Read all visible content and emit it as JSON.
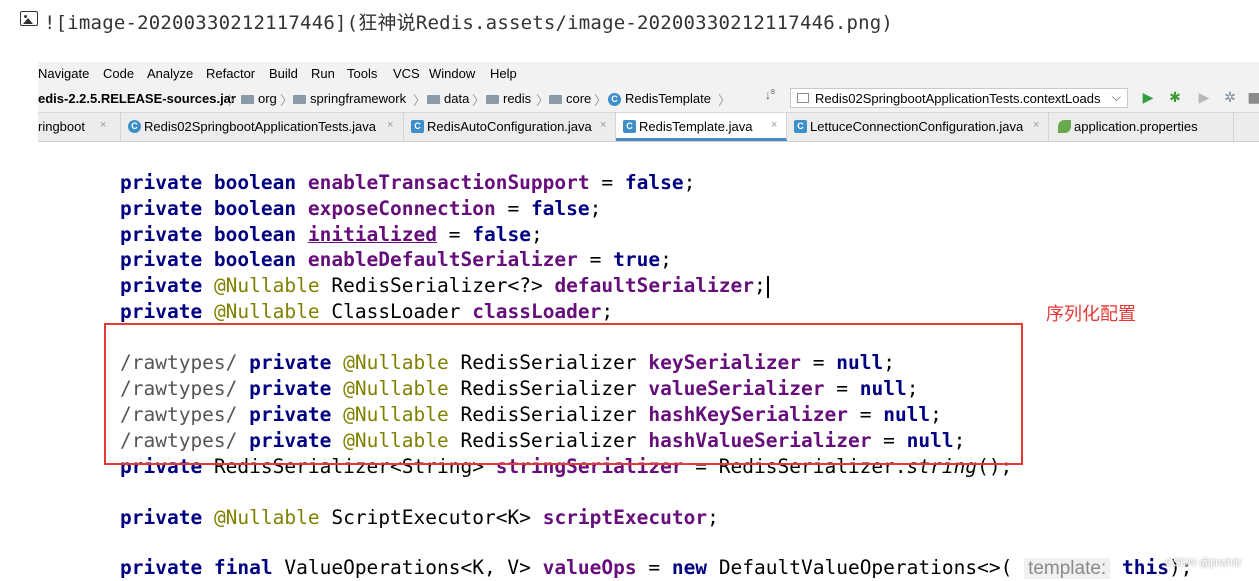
{
  "markdown": {
    "text": "![image-20200330212117446](狂神说Redis.assets/image-20200330212117446.png)"
  },
  "menu": [
    "Navigate",
    "Code",
    "Analyze",
    "Refactor",
    "Build",
    "Run",
    "Tools",
    "VCS",
    "Window",
    "Help"
  ],
  "breadcrumb": {
    "jar": "edis-2.2.5.RELEASE-sources.jar",
    "folders": [
      "org",
      "springframework",
      "data",
      "redis",
      "core"
    ],
    "class": "RedisTemplate"
  },
  "run_config": {
    "label": "Redis02SpringbootApplicationTests.contextLoads"
  },
  "tabs": [
    {
      "label": "ringboot",
      "active": false
    },
    {
      "label": "Redis02SpringbootApplicationTests.java",
      "active": false
    },
    {
      "label": "RedisAutoConfiguration.java",
      "active": false
    },
    {
      "label": "RedisTemplate.java",
      "active": true
    },
    {
      "label": "LettuceConnectionConfiguration.java",
      "active": false
    },
    {
      "label": "application.properties",
      "active": false
    }
  ],
  "code": {
    "l1": {
      "kw": "private boolean",
      "field": "enableTransactionSupport",
      "rest": " = ",
      "val": "false",
      "end": ";"
    },
    "l2": {
      "kw": "private boolean",
      "field": "exposeConnection",
      "rest": " = ",
      "val": "false",
      "end": ";"
    },
    "l3": {
      "kw": "private boolean",
      "field": "initialized",
      "rest": " = ",
      "val": "false",
      "end": ";"
    },
    "l4": {
      "kw": "private boolean",
      "field": "enableDefaultSerializer",
      "rest": " = ",
      "val": "true",
      "end": ";"
    },
    "l5": {
      "kw": "private",
      "ann": "@Nullable",
      "type": "RedisSerializer<?>",
      "field": "defaultSerializer",
      "end": ";"
    },
    "l6": {
      "kw": "private",
      "ann": "@Nullable",
      "type": "ClassLoader",
      "field": "classLoader",
      "end": ";"
    },
    "l7": {
      "cmt": "/rawtypes/",
      "kw": "private",
      "ann": "@Nullable",
      "type": "RedisSerializer",
      "field": "keySerializer",
      "rest": " = ",
      "val": "null",
      "end": ";"
    },
    "l8": {
      "cmt": "/rawtypes/",
      "kw": "private",
      "ann": "@Nullable",
      "type": "RedisSerializer",
      "field": "valueSerializer",
      "rest": " = ",
      "val": "null",
      "end": ";"
    },
    "l9": {
      "cmt": "/rawtypes/",
      "kw": "private",
      "ann": "@Nullable",
      "type": "RedisSerializer",
      "field": "hashKeySerializer",
      "rest": " = ",
      "val": "null",
      "end": ";"
    },
    "l10": {
      "cmt": "/rawtypes/",
      "kw": "private",
      "ann": "@Nullable",
      "type": "RedisSerializer",
      "field": "hashValueSerializer",
      "rest": " = ",
      "val": "null",
      "end": ";"
    },
    "l11": {
      "kw": "private",
      "type": "RedisSerializer<String>",
      "field": "stringSerializer",
      "rest": " = RedisSerializer.",
      "method": "string",
      "end": "();"
    },
    "l12": {
      "kw": "private",
      "ann": "@Nullable",
      "type": "ScriptExecutor<K>",
      "field": "scriptExecutor",
      "end": ";"
    },
    "l13": {
      "kw": "private final",
      "type": "ValueOperations<K, V>",
      "field": "valueOps",
      "rest": " = ",
      "kw2": "new",
      "type2": "DefaultValueOperations<>(",
      "hint": "template:",
      "kw3": "this",
      "end": ");"
    }
  },
  "annotation_note": "序列化配置",
  "watermark": "CSDN @jinshiir",
  "colors": {
    "keyword": "#000080",
    "field": "#660e7a",
    "annotation": "#808000",
    "highlight_box": "#e53935",
    "active_tab_underline": "#4a88c7"
  }
}
